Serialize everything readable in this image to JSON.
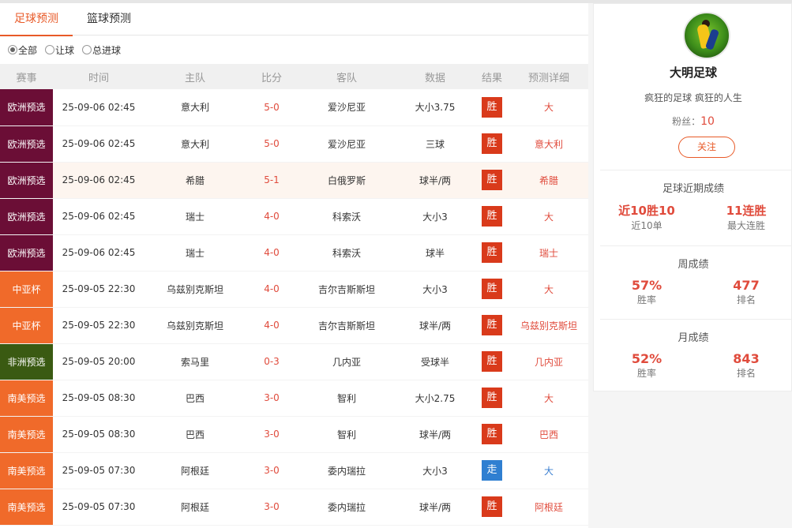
{
  "tabs": [
    {
      "label": "足球预测",
      "active": true
    },
    {
      "label": "篮球预测",
      "active": false
    }
  ],
  "filters": [
    {
      "label": "全部",
      "checked": true
    },
    {
      "label": "让球",
      "checked": false
    },
    {
      "label": "总进球",
      "checked": false
    }
  ],
  "columns": [
    "赛事",
    "时间",
    "主队",
    "比分",
    "客队",
    "数据",
    "结果",
    "预测详细"
  ],
  "colors": {
    "accent": "#e85a28",
    "win": "#d93a1b",
    "push": "#2f7fd1",
    "league_euro": "#6b0e36",
    "league_asia": "#f06a2a",
    "league_africa": "#3a5a12",
    "league_sa": "#f06a2a"
  },
  "rows": [
    {
      "league": "欧洲预选",
      "league_color": "#6b0e36",
      "time": "25-09-06 02:45",
      "home": "意大利",
      "score": "5-0",
      "away": "爱沙尼亚",
      "data": "大小3.75",
      "result": "胜",
      "result_type": "win",
      "pred": "大",
      "pred_type": "red",
      "highlight": false
    },
    {
      "league": "欧洲预选",
      "league_color": "#6b0e36",
      "time": "25-09-06 02:45",
      "home": "意大利",
      "score": "5-0",
      "away": "爱沙尼亚",
      "data": "三球",
      "result": "胜",
      "result_type": "win",
      "pred": "意大利",
      "pred_type": "red",
      "highlight": false
    },
    {
      "league": "欧洲预选",
      "league_color": "#6b0e36",
      "time": "25-09-06 02:45",
      "home": "希腊",
      "score": "5-1",
      "away": "白俄罗斯",
      "data": "球半/两",
      "result": "胜",
      "result_type": "win",
      "pred": "希腊",
      "pred_type": "red",
      "highlight": true
    },
    {
      "league": "欧洲预选",
      "league_color": "#6b0e36",
      "time": "25-09-06 02:45",
      "home": "瑞士",
      "score": "4-0",
      "away": "科索沃",
      "data": "大小3",
      "result": "胜",
      "result_type": "win",
      "pred": "大",
      "pred_type": "red",
      "highlight": false
    },
    {
      "league": "欧洲预选",
      "league_color": "#6b0e36",
      "time": "25-09-06 02:45",
      "home": "瑞士",
      "score": "4-0",
      "away": "科索沃",
      "data": "球半",
      "result": "胜",
      "result_type": "win",
      "pred": "瑞士",
      "pred_type": "red",
      "highlight": false
    },
    {
      "league": "中亚杯",
      "league_color": "#f06a2a",
      "time": "25-09-05 22:30",
      "home": "乌兹别克斯坦",
      "score": "4-0",
      "away": "吉尔吉斯斯坦",
      "data": "大小3",
      "result": "胜",
      "result_type": "win",
      "pred": "大",
      "pred_type": "red",
      "highlight": false
    },
    {
      "league": "中亚杯",
      "league_color": "#f06a2a",
      "time": "25-09-05 22:30",
      "home": "乌兹别克斯坦",
      "score": "4-0",
      "away": "吉尔吉斯斯坦",
      "data": "球半/两",
      "result": "胜",
      "result_type": "win",
      "pred": "乌兹别克斯坦",
      "pred_type": "red",
      "highlight": false
    },
    {
      "league": "非洲预选",
      "league_color": "#3a5a12",
      "time": "25-09-05 20:00",
      "home": "索马里",
      "score": "0-3",
      "away": "几内亚",
      "data": "受球半",
      "result": "胜",
      "result_type": "win",
      "pred": "几内亚",
      "pred_type": "red",
      "highlight": false
    },
    {
      "league": "南美预选",
      "league_color": "#f06a2a",
      "time": "25-09-05 08:30",
      "home": "巴西",
      "score": "3-0",
      "away": "智利",
      "data": "大小2.75",
      "result": "胜",
      "result_type": "win",
      "pred": "大",
      "pred_type": "red",
      "highlight": false
    },
    {
      "league": "南美预选",
      "league_color": "#f06a2a",
      "time": "25-09-05 08:30",
      "home": "巴西",
      "score": "3-0",
      "away": "智利",
      "data": "球半/两",
      "result": "胜",
      "result_type": "win",
      "pred": "巴西",
      "pred_type": "red",
      "highlight": false
    },
    {
      "league": "南美预选",
      "league_color": "#f06a2a",
      "time": "25-09-05 07:30",
      "home": "阿根廷",
      "score": "3-0",
      "away": "委内瑞拉",
      "data": "大小3",
      "result": "走",
      "result_type": "push",
      "pred": "大",
      "pred_type": "blue",
      "highlight": false
    },
    {
      "league": "南美预选",
      "league_color": "#f06a2a",
      "time": "25-09-05 07:30",
      "home": "阿根廷",
      "score": "3-0",
      "away": "委内瑞拉",
      "data": "球半/两",
      "result": "胜",
      "result_type": "win",
      "pred": "阿根廷",
      "pred_type": "red",
      "highlight": false
    }
  ],
  "profile": {
    "name": "大明足球",
    "motto": "疯狂的足球 疯狂的人生",
    "fans_label": "粉丝：",
    "fans": "10",
    "follow_label": "关注",
    "recent": {
      "title": "足球近期成绩",
      "left_value": "近10胜10",
      "left_label": "近10单",
      "right_value": "11连胜",
      "right_label": "最大连胜"
    },
    "week": {
      "title": "周成绩",
      "rate": "57%",
      "rate_label": "胜率",
      "rank": "477",
      "rank_label": "排名"
    },
    "month": {
      "title": "月成绩",
      "rate": "52%",
      "rate_label": "胜率",
      "rank": "843",
      "rank_label": "排名"
    }
  }
}
